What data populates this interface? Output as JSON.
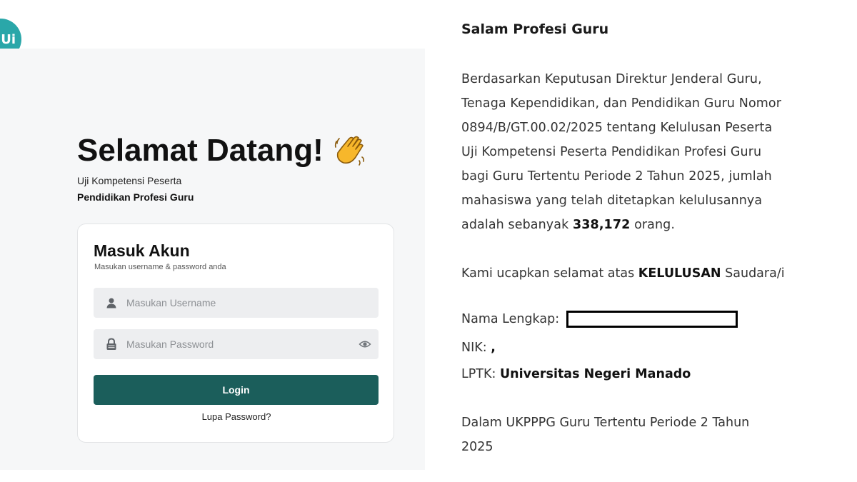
{
  "logo": {
    "text": "Ui",
    "color": "#2aa7a9"
  },
  "login": {
    "heading": "Selamat Datang!",
    "heading_icon": "waving-hand-icon",
    "subtitle_line1": "Uji Kompetensi Peserta",
    "subtitle_line2": "Pendidikan Profesi Guru",
    "card": {
      "title": "Masuk Akun",
      "subtitle": "Masukan username & password anda",
      "username_placeholder": "Masukan Username",
      "password_placeholder": "Masukan Password",
      "login_label": "Login",
      "forgot_label": "Lupa Password?"
    },
    "button_color": "#1b5e5b"
  },
  "announcement": {
    "greeting": "Salam Profesi Guru",
    "paragraph_lines": [
      "Berdasarkan Keputusan Direktur Jenderal Guru,",
      "Tenaga Kependidikan, dan Pendidikan Guru Nomor",
      "0894/B/GT.00.02/2025 tentang Kelulusan Peserta",
      "Uji Kompetensi Peserta Pendidikan Profesi Guru",
      "bagi Guru Tertentu Periode 2 Tahun 2025, jumlah",
      "mahasiswa yang telah ditetapkan kelulusannya"
    ],
    "last_line_prefix": "adalah sebanyak ",
    "graduate_count": "338,172",
    "last_line_suffix": " orang.",
    "congrats_prefix": "Kami ucapkan selamat atas ",
    "congrats_bold": "KELULUSAN",
    "congrats_suffix": " Saudara/i",
    "name_label": "Nama Lengkap:",
    "nik_label": "NIK:",
    "nik_value": ",",
    "lptk_label": "LPTK:",
    "lptk_value": "Universitas Negeri Manado",
    "closing_line1": "Dalam UKPPPG Guru Tertentu Periode 2 Tahun",
    "closing_line2": "2025"
  }
}
